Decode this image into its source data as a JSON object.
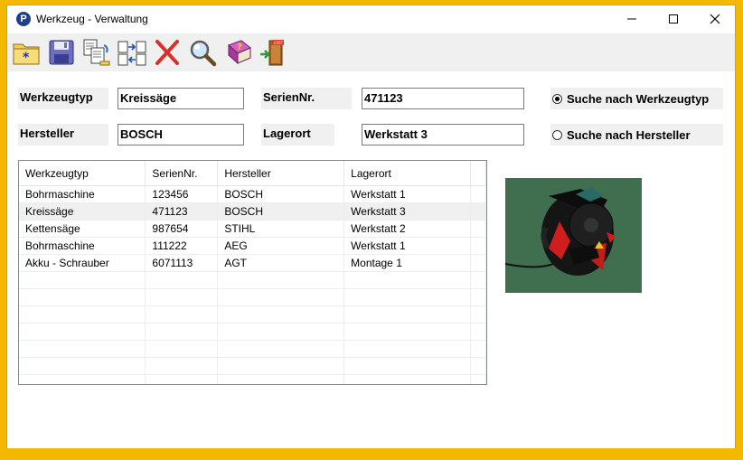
{
  "window": {
    "title": "Werkzeug - Verwaltung",
    "app_icon_letter": "P"
  },
  "toolbar": {
    "items": [
      {
        "icon": "new-folder-icon"
      },
      {
        "icon": "save-disk-icon"
      },
      {
        "icon": "copy-documents-icon"
      },
      {
        "icon": "transfer-arrows-icon"
      },
      {
        "icon": "delete-x-icon"
      },
      {
        "icon": "search-magnifier-icon"
      },
      {
        "icon": "help-book-icon"
      },
      {
        "icon": "exit-door-icon",
        "text": "EXIT"
      }
    ]
  },
  "form": {
    "werkzeugtyp_label": "Werkzeugtyp",
    "werkzeugtyp_value": "Kreissäge",
    "seriennr_label": "SerienNr.",
    "seriennr_value": "471123",
    "hersteller_label": "Hersteller",
    "hersteller_value": "BOSCH",
    "lagerort_label": "Lagerort",
    "lagerort_value": "Werkstatt 3"
  },
  "search": {
    "by_type_label": "Suche nach Werkzeugtyp",
    "by_type_selected": true,
    "by_manufacturer_label": "Suche nach Hersteller",
    "by_manufacturer_selected": false
  },
  "table": {
    "columns": [
      "Werkzeugtyp",
      "SerienNr.",
      "Hersteller",
      "Lagerort"
    ],
    "rows": [
      [
        "Bohrmaschine",
        "123456",
        "BOSCH",
        "Werkstatt 1"
      ],
      [
        "Kreissäge",
        "471123",
        "BOSCH",
        "Werkstatt 3"
      ],
      [
        "Kettensäge",
        "987654",
        "STIHL",
        "Werkstatt 2"
      ],
      [
        "Bohrmaschine",
        "111222",
        "AEG",
        "Werkstatt 1"
      ],
      [
        "Akku - Schrauber",
        "6071113",
        "AGT",
        "Montage 1"
      ]
    ],
    "selected_row": 1,
    "empty_rows": 7
  },
  "image": {
    "icon": "circular-saw-photo"
  },
  "colors": {
    "desktop_border": "#f5b800",
    "selection": "#f0f0f0",
    "photo_background": "#3f6f4f"
  }
}
